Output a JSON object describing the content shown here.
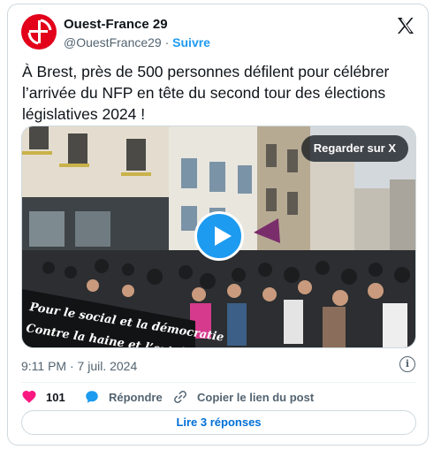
{
  "author": {
    "name": "Ouest-France 29",
    "handle": "@OuestFrance29",
    "separator": "·",
    "follow_label": "Suivre"
  },
  "tweet": {
    "text": "À Brest, près de 500 personnes défilent pour célébrer l’arrivée du NFP en tête du second tour des élections législatives 2024 !",
    "timestamp": "9:11 PM · 7 juil. 2024"
  },
  "media": {
    "watch_label": "Regarder sur X",
    "banner_line1": "Pour le social et la démocratie",
    "banner_line2": "Contre la haine et l’extrême droite"
  },
  "actions": {
    "like_count": "101",
    "reply_label": "Répondre",
    "copy_label": "Copier le lien du post",
    "read_replies_label": "Lire 3 réponses"
  },
  "icons": {
    "avatar": "ouest-france-logo",
    "brand": "x-logo-icon",
    "info": "info-icon",
    "like": "heart-icon",
    "reply": "speech-bubble-icon",
    "copy": "link-icon"
  },
  "colors": {
    "accent": "#1d9bf0",
    "like": "#f91880",
    "link": "#006fd6",
    "brand_red": "#e2001a"
  }
}
